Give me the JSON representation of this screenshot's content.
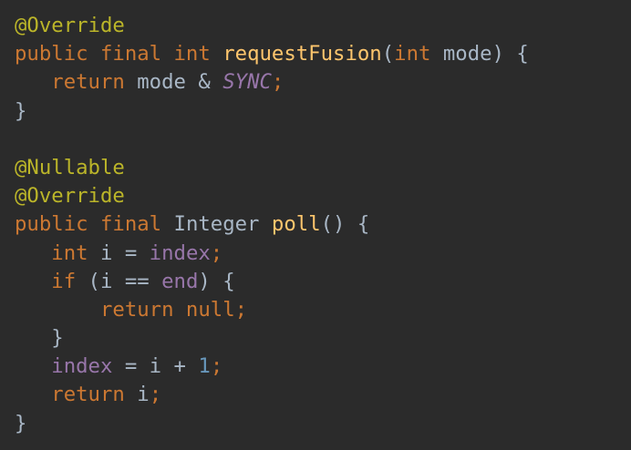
{
  "editor": {
    "background": "#2b2b2b",
    "lines": [
      [
        {
          "text": "@Override",
          "kind": "ann"
        }
      ],
      [
        {
          "text": "public final int ",
          "kind": "kw"
        },
        {
          "text": "requestFusion",
          "kind": "fn"
        },
        {
          "text": "(",
          "kind": "plain"
        },
        {
          "text": "int ",
          "kind": "kw"
        },
        {
          "text": "mode) {",
          "kind": "plain"
        }
      ],
      [
        {
          "text": "   return ",
          "kind": "kw"
        },
        {
          "text": "mode & ",
          "kind": "plain"
        },
        {
          "text": "SYNC",
          "kind": "italic"
        },
        {
          "text": ";",
          "kind": "punct"
        }
      ],
      [
        {
          "text": "}",
          "kind": "plain"
        }
      ],
      [],
      [
        {
          "text": "@Nullable",
          "kind": "ann"
        }
      ],
      [
        {
          "text": "@Override",
          "kind": "ann"
        }
      ],
      [
        {
          "text": "public final ",
          "kind": "kw"
        },
        {
          "text": "Integer ",
          "kind": "plain"
        },
        {
          "text": "poll",
          "kind": "fn"
        },
        {
          "text": "() {",
          "kind": "plain"
        }
      ],
      [
        {
          "text": "   int ",
          "kind": "kw"
        },
        {
          "text": "i = ",
          "kind": "plain"
        },
        {
          "text": "index",
          "kind": "field"
        },
        {
          "text": ";",
          "kind": "punct"
        }
      ],
      [
        {
          "text": "   if ",
          "kind": "kw"
        },
        {
          "text": "(i == ",
          "kind": "plain"
        },
        {
          "text": "end",
          "kind": "field"
        },
        {
          "text": ") {",
          "kind": "plain"
        }
      ],
      [
        {
          "text": "       return null",
          "kind": "kw"
        },
        {
          "text": ";",
          "kind": "punct"
        }
      ],
      [
        {
          "text": "   }",
          "kind": "plain"
        }
      ],
      [
        {
          "text": "   index ",
          "kind": "field"
        },
        {
          "text": "= i + ",
          "kind": "plain"
        },
        {
          "text": "1",
          "kind": "num"
        },
        {
          "text": ";",
          "kind": "punct"
        }
      ],
      [
        {
          "text": "   return ",
          "kind": "kw"
        },
        {
          "text": "i",
          "kind": "plain"
        },
        {
          "text": ";",
          "kind": "punct"
        }
      ],
      [
        {
          "text": "}",
          "kind": "plain"
        }
      ]
    ]
  }
}
